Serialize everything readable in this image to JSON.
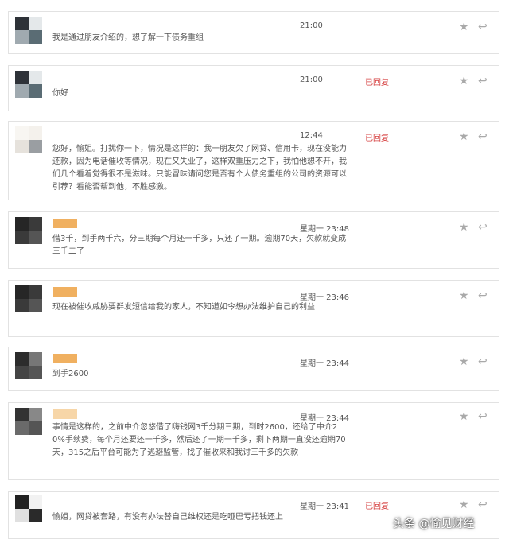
{
  "messages": [
    {
      "text": "我是通过朋友介绍的，想了解一下债务重组",
      "time": "21:00",
      "status": ""
    },
    {
      "text": "你好",
      "time": "21:00",
      "status": "已回复"
    },
    {
      "text": "您好，愉姐。打扰你一下，情况是这样的：我一朋友欠了网贷、信用卡，现在没能力还款，因为电话催收等情况，现在又失业了，这样双重压力之下，我怕他想不开，我们几个看着觉得很不是滋味。只能冒昧请问您是否有个人债务重组的公司的资源可以引荐？看能否帮到他，不胜感激。",
      "time": "12:44",
      "status": "已回复"
    },
    {
      "text": "借3千，到手两千六，分三期每个月还一千多，只还了一期。逾期70天，欠款就变成三千二了",
      "time": "星期一 23:48",
      "status": ""
    },
    {
      "text": "现在被催收威胁要群发短信给我的家人，不知道如今想办法维护自己的利益",
      "time": "星期一 23:46",
      "status": ""
    },
    {
      "text": "到手2600",
      "time": "星期一 23:44",
      "status": ""
    },
    {
      "text": "事情是这样的，之前中介忽悠借了嗨钱网3千分期三期，到时2600，还给了中介20%手续费，每个月还要还一千多，然后还了一期一千多，剩下两期一直没还逾期70天，315之后平台可能为了逃避监管，找了催收来和我讨三千多的欠款",
      "time": "星期一 23:44",
      "status": ""
    },
    {
      "text": "愉姐，网贷被套路，有没有办法替自己维权还是吃哑巴亏把钱还上",
      "time": "星期一 23:41",
      "status": "已回复"
    }
  ],
  "icons": {
    "star": "star-icon",
    "reply": "reply-arrow-icon"
  },
  "colors": {
    "replied": "#d64040",
    "icon": "#a9a9a9",
    "border": "#e2e2e2",
    "tag": "#f0b060"
  },
  "watermark": "头条 @愉见财经"
}
